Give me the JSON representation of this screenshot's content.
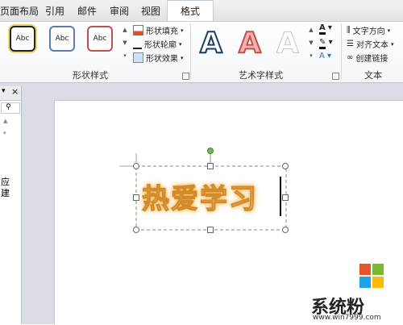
{
  "tabs": [
    "页面布局",
    "引用",
    "邮件",
    "审阅",
    "视图",
    "格式"
  ],
  "shape_styles": {
    "thumbs": [
      "Abc",
      "Abc",
      "Abc"
    ],
    "fill": "形状填充",
    "outline": "形状轮廓",
    "effects": "形状效果",
    "group_label": "形状样式"
  },
  "wordart_styles": {
    "glyph": "A",
    "group_label": "艺术字样式"
  },
  "text_group": {
    "direction": "文字方向",
    "align": "对齐文本",
    "link": "创建链接",
    "group_label": "文本"
  },
  "pane": {
    "close": "×",
    "lines": [
      "应",
      "建"
    ]
  },
  "slide": {
    "wordart_text": "热爱学习"
  },
  "watermark": {
    "name": "系统粉",
    "url": "www.win7999.com"
  },
  "colors": {
    "accent_tab": "#2f6fd1",
    "wordart_glow": "#f6b24b"
  }
}
